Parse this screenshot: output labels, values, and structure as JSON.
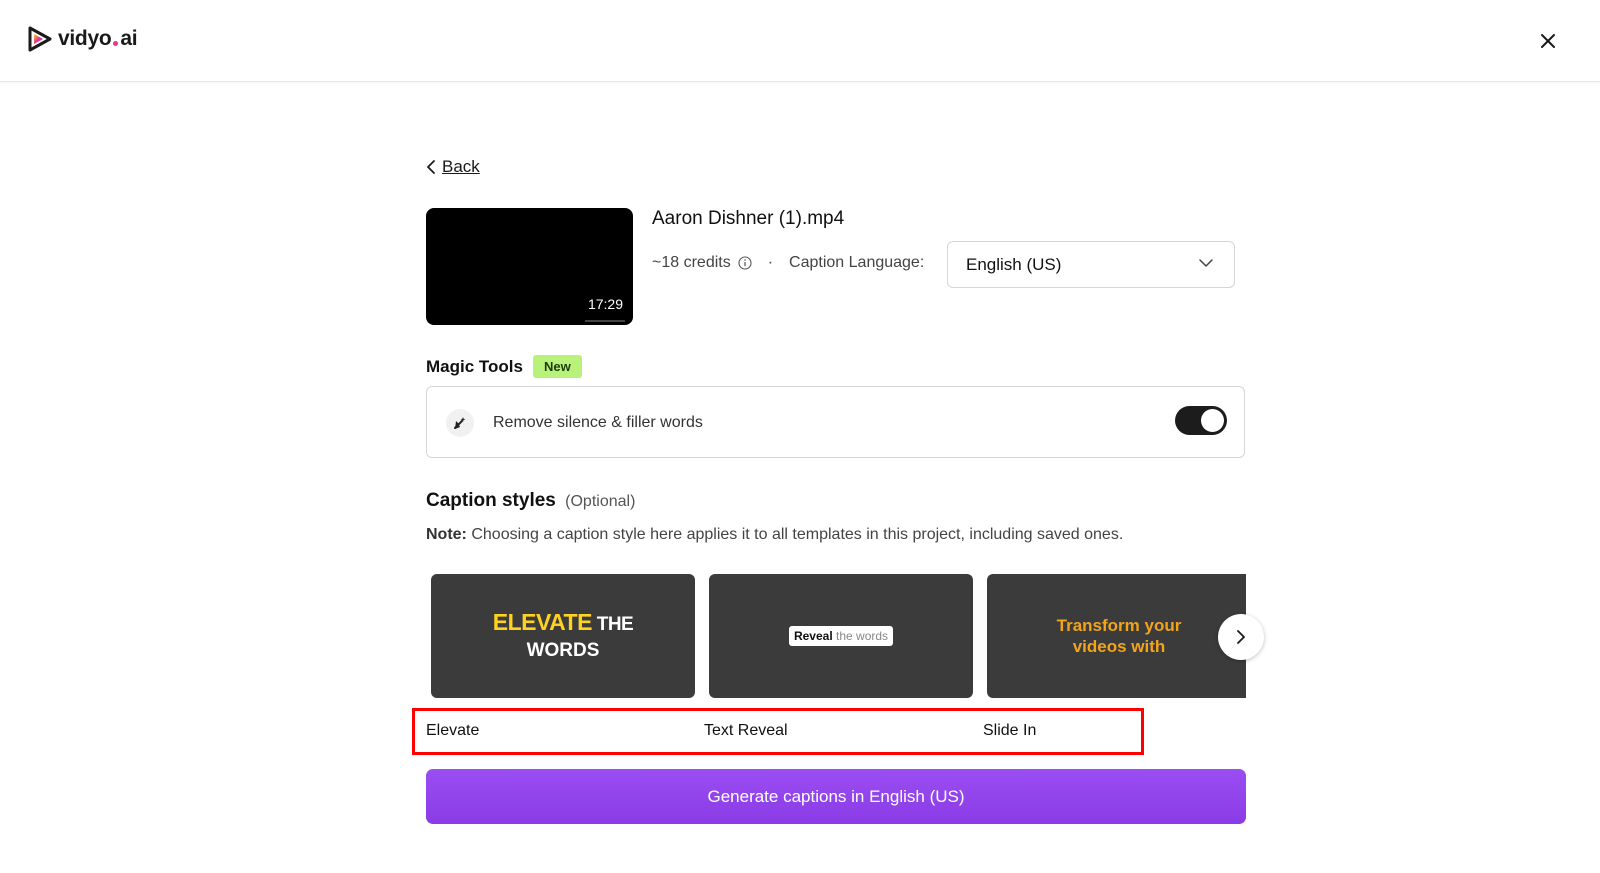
{
  "header": {
    "logo_text_left": "vidyo",
    "logo_text_right": "ai",
    "close_icon": "close-icon"
  },
  "nav": {
    "back_label": "Back"
  },
  "video": {
    "filename": "Aaron Dishner (1).mp4",
    "duration": "17:29",
    "credits": "~18 credits",
    "caption_language_label": "Caption Language:",
    "caption_language_value": "English (US)"
  },
  "magic_tools": {
    "title": "Magic Tools",
    "badge": "New",
    "option_label": "Remove silence & filler words",
    "option_enabled": true
  },
  "caption_styles": {
    "title": "Caption styles",
    "optional": "(Optional)",
    "note_bold": "Note:",
    "note_text": " Choosing a caption style here applies it to all templates in this project, including saved ones.",
    "cards": [
      {
        "name": "Elevate",
        "preview": {
          "highlight": "ELEVATE",
          "rest": " THE",
          "line2": "WORDS"
        }
      },
      {
        "name": "Text Reveal",
        "preview": {
          "bold": "Reveal",
          "faded": " the words"
        }
      },
      {
        "name": "Slide In",
        "preview": {
          "line1": "Transform your",
          "line2": "videos with"
        }
      }
    ]
  },
  "actions": {
    "generate_label": "Generate captions in English (US)"
  },
  "colors": {
    "accent": "#9145ec",
    "new_badge": "#b9f27a",
    "highlight_box": "#ff0000",
    "card_bg": "#3b3b3b"
  }
}
